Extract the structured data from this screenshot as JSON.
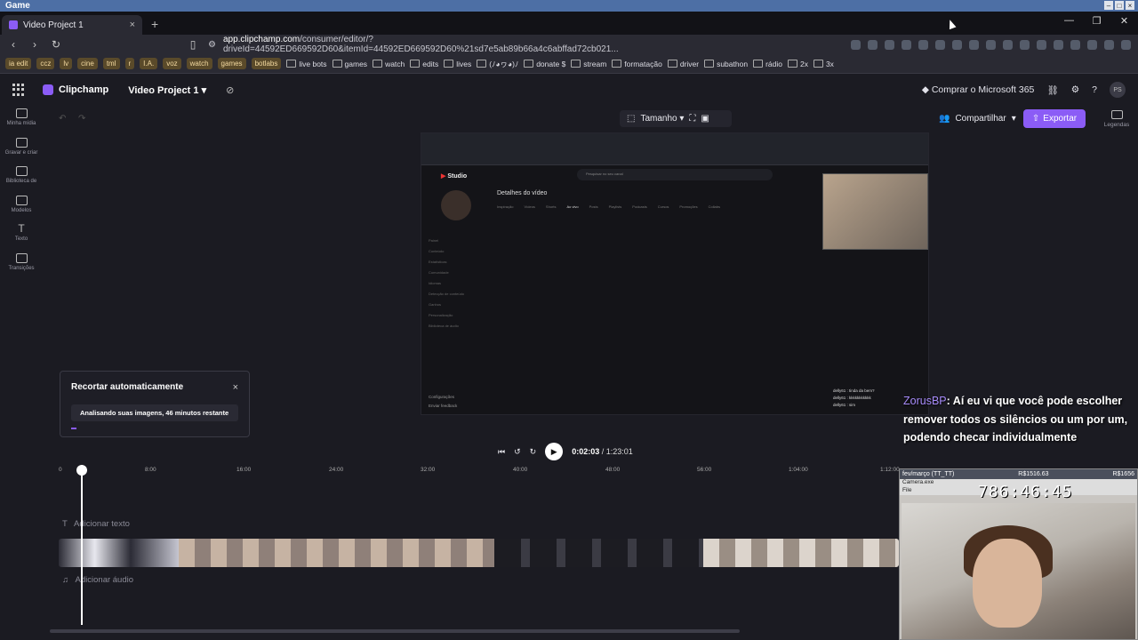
{
  "os_window": {
    "title": "Game"
  },
  "browser": {
    "tabs": [
      {
        "label": "Video Project 1",
        "active": true
      }
    ],
    "url_host": "app.clipchamp.com",
    "url_rest": "/consumer/editor/?driveId=44592ED669592D60&itemId=44592ED669592D60%21sd7e5ab89b66a4c6abffad72cb021...",
    "bookmarks_chips": [
      "ia edit",
      "ccz",
      "lv",
      "cine",
      "tml",
      "r",
      "I.A.",
      "voz",
      "watch",
      "games",
      "botlabs"
    ],
    "bookmarks": [
      "live bots",
      "games",
      "watch",
      "edits",
      "lives",
      "(ﾉ◕ヮ◕)ﾉ",
      "donate $",
      "stream",
      "formatação",
      "driver",
      "subathon",
      "rádio",
      "2x",
      "3x"
    ]
  },
  "app": {
    "name": "Clipchamp",
    "project_name": "Video Project 1",
    "buy_label": "Comprar o Microsoft 365",
    "avatar_initials": "PS"
  },
  "sidebar": {
    "items": [
      {
        "label": "Minha mídia",
        "icon": "folder-icon"
      },
      {
        "label": "Gravar e criar",
        "icon": "camera-icon"
      },
      {
        "label": "Biblioteca de",
        "icon": "library-icon"
      },
      {
        "label": "Modelos",
        "icon": "templates-icon"
      },
      {
        "label": "Texto",
        "icon": "text-icon"
      },
      {
        "label": "Transições",
        "icon": "transitions-icon"
      }
    ]
  },
  "toolbar": {
    "size_label": "Tamanho"
  },
  "share_label": "Compartilhar",
  "export_label": "Exportar",
  "captions_label": "Legendas",
  "preview": {
    "studio_label": "Studio",
    "search_placeholder": "Pesquisar no seu canal",
    "page_title": "Detalhes do vídeo",
    "tabs": [
      "Inspiração",
      "Vídeos",
      "Shorts",
      "Ao vivo",
      "Posts",
      "Playlists",
      "Podcasts",
      "Cursos",
      "Promoções",
      "Collabs"
    ],
    "menu": [
      "Painel",
      "Conteúdo",
      "Estatísticas",
      "Comunidade",
      "Idiomas",
      "Detecção de conteúdo",
      "Ganhos",
      "Personalização",
      "Biblioteca de áudio"
    ],
    "config": [
      "Configurações",
      "Enviar feedback"
    ],
    "chat": [
      "delly61 : tinda da bem?",
      "delly61 : kkkkkkkkkkk",
      "delly61 : sim"
    ]
  },
  "autocut": {
    "title": "Recortar automaticamente",
    "message": "Analisando suas imagens, 46 minutos restante",
    "progress": 0.03
  },
  "player": {
    "current_time": "0:02:03",
    "total_time": "1:23:01"
  },
  "timeline": {
    "ruler": [
      "0",
      "8:00",
      "16:00",
      "24:00",
      "32:00",
      "40:00",
      "48:00",
      "56:00",
      "1:04:00",
      "1:12:00"
    ],
    "add_text": "Adicionar texto",
    "add_audio": "Adicionar áudio"
  },
  "overlay": {
    "chat_user": "ZorusBP",
    "chat_message": ": Aí eu vi que você pode escolher remover todos os silêncios ou um por um, podendo checar individualmente",
    "camera_date": "fev/março (TT_TT)",
    "camera_amount_left": "R$1516.63",
    "camera_amount_right": "R$1656",
    "camera_app": "Camera.exe",
    "camera_menu": "File",
    "camera_clock": "786:46:45"
  }
}
